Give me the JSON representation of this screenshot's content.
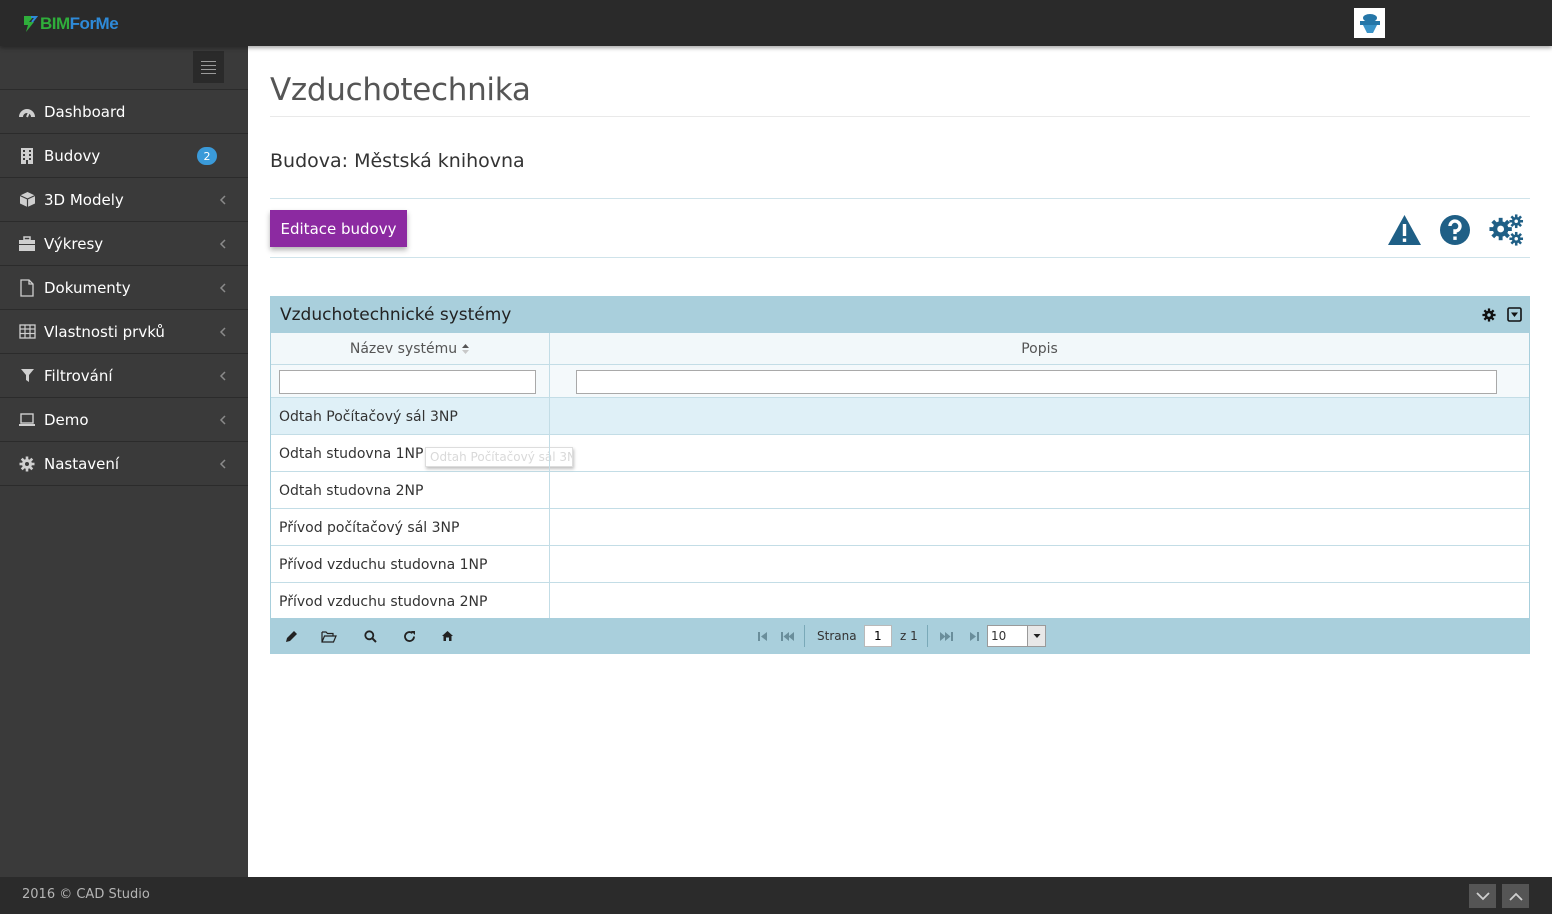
{
  "app": {
    "logo_part1": "BIM",
    "logo_part2": "ForMe"
  },
  "colors": {
    "accent_purple": "#8c2aa1",
    "grid_header": "#a9cfdc",
    "badge_blue": "#3a9ad9",
    "sidebar_bg": "#3a3a3a",
    "topbar_bg": "#2a2a2a",
    "icon_blue": "#1f5f86"
  },
  "sidebar": {
    "items": [
      {
        "label": "Dashboard",
        "icon": "dashboard-icon"
      },
      {
        "label": "Budovy",
        "icon": "building-icon",
        "badge": "2"
      },
      {
        "label": "3D Modely",
        "icon": "cube-icon"
      },
      {
        "label": "Výkresy",
        "icon": "briefcase-icon"
      },
      {
        "label": "Dokumenty",
        "icon": "document-icon"
      },
      {
        "label": "Vlastnosti prvků",
        "icon": "table-icon"
      },
      {
        "label": "Filtrování",
        "icon": "filter-icon"
      },
      {
        "label": "Demo",
        "icon": "laptop-icon"
      },
      {
        "label": "Nastavení",
        "icon": "gear-icon"
      }
    ]
  },
  "main": {
    "title": "Vzduchotechnika",
    "building_label": "Budova: Městská knihovna",
    "edit_button": "Editace budovy",
    "toolbar_icons": [
      "warning-icon",
      "help-icon",
      "settings-gears-icon"
    ]
  },
  "grid": {
    "caption": "Vzduchotechnické systémy",
    "columns": [
      "Název systému",
      "Popis"
    ],
    "filters": {
      "name": "",
      "description": ""
    },
    "rows": [
      {
        "name": "Odtah Počítačový sál 3NP",
        "description": ""
      },
      {
        "name": "Odtah studovna 1NP",
        "description": ""
      },
      {
        "name": "Odtah studovna 2NP",
        "description": ""
      },
      {
        "name": "Přívod počítačový sál 3NP",
        "description": ""
      },
      {
        "name": "Přívod vzduchu studovna 1NP",
        "description": ""
      },
      {
        "name": "Přívod vzduchu studovna 2NP",
        "description": ""
      }
    ],
    "tooltip": "Odtah Počítačový sál 3NP",
    "pager": {
      "page_label": "Strana",
      "page_value": "1",
      "of_label": "z 1",
      "rows_per_page": "10"
    }
  },
  "footer": {
    "copyright": "2016 © CAD Studio"
  }
}
